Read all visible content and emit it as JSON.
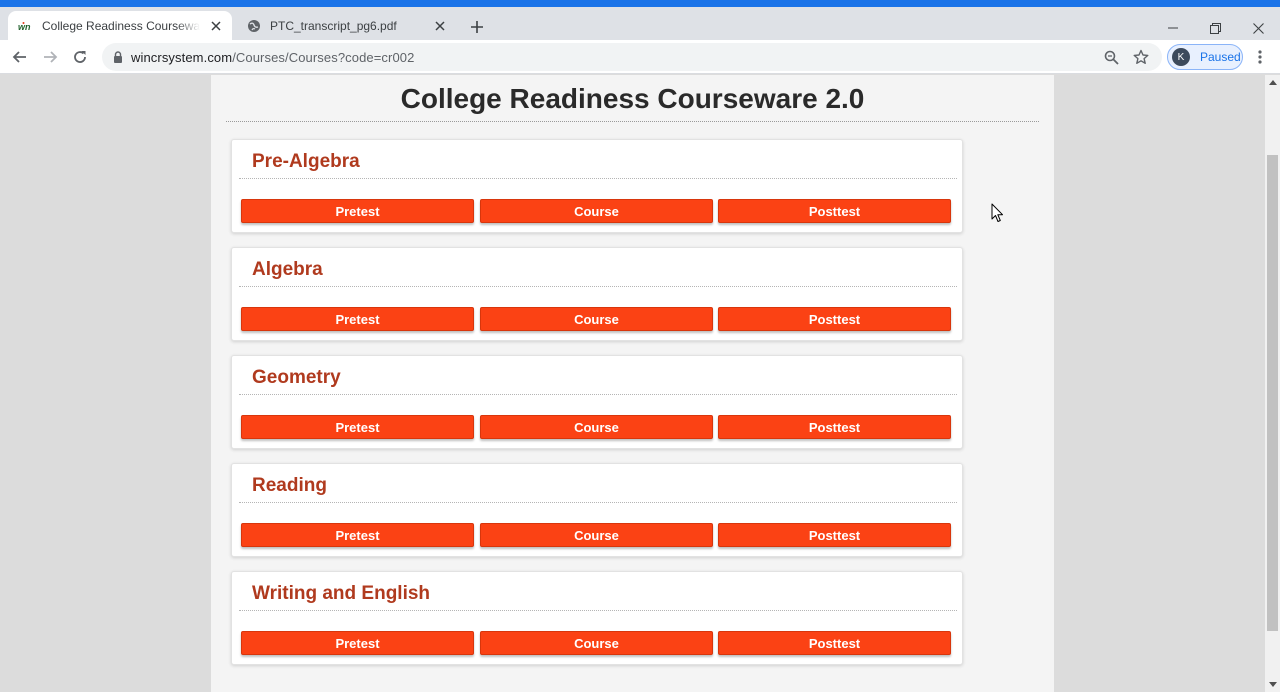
{
  "browser": {
    "tabs": [
      {
        "title": "College Readiness Courseware 2.0",
        "favicon": "win-logo-icon",
        "active": true
      },
      {
        "title": "PTC_transcript_pg6.pdf",
        "favicon": "globe-icon",
        "active": false
      }
    ],
    "url_host": "wincrsystem.com",
    "url_path": "/Courses/Courses?code=cr002",
    "profile_initial": "K",
    "profile_status": "Paused",
    "accent_color": "#1a73e8"
  },
  "page": {
    "title": "College Readiness Courseware 2.0",
    "courses": [
      {
        "name": "Pre-Algebra",
        "buttons": [
          "Pretest",
          "Course",
          "Posttest"
        ]
      },
      {
        "name": "Algebra",
        "buttons": [
          "Pretest",
          "Course",
          "Posttest"
        ]
      },
      {
        "name": "Geometry",
        "buttons": [
          "Pretest",
          "Course",
          "Posttest"
        ]
      },
      {
        "name": "Reading",
        "buttons": [
          "Pretest",
          "Course",
          "Posttest"
        ]
      },
      {
        "name": "Writing and English",
        "buttons": [
          "Pretest",
          "Course",
          "Posttest"
        ]
      }
    ],
    "button_color": "#fb4214",
    "heading_color": "#b03a1e"
  }
}
